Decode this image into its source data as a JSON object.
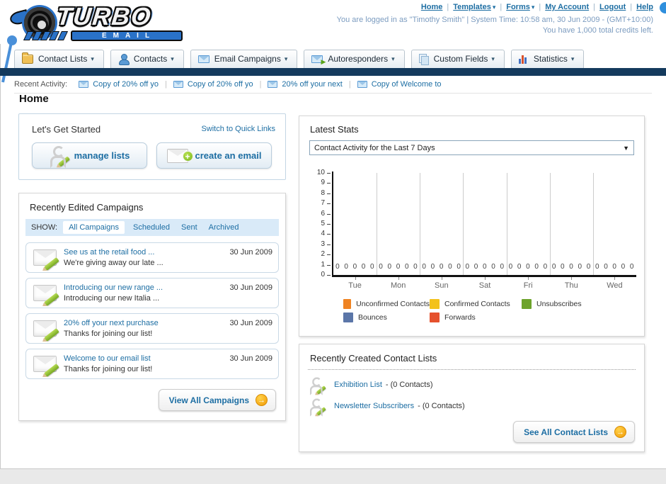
{
  "header": {
    "logo": {
      "line1": "TURBO",
      "line2": "EMAIL"
    },
    "nav": [
      {
        "label": "Home",
        "dropdown": false
      },
      {
        "label": "Templates",
        "dropdown": true
      },
      {
        "label": "Forms",
        "dropdown": true
      },
      {
        "label": "My Account",
        "dropdown": false
      },
      {
        "label": "Logout",
        "dropdown": false
      },
      {
        "label": "Help",
        "dropdown": false
      }
    ],
    "login_line": "You are logged in as \"Timothy Smith\" | System Time: 10:58 am, 30 Jun 2009 - (GMT+10:00)",
    "credits_line": "You have 1,000 total credits left."
  },
  "tabs": [
    {
      "label": "Contact Lists",
      "icon": "contact-lists-icon"
    },
    {
      "label": "Contacts",
      "icon": "contacts-icon"
    },
    {
      "label": "Email Campaigns",
      "icon": "email-campaigns-icon"
    },
    {
      "label": "Autoresponders",
      "icon": "autoresponders-icon"
    },
    {
      "label": "Custom Fields",
      "icon": "custom-fields-icon"
    },
    {
      "label": "Statistics",
      "icon": "statistics-icon"
    }
  ],
  "recent_activity": {
    "label": "Recent Activity:",
    "items": [
      "Copy of 20% off yo",
      "Copy of 20% off yo",
      "20% off your next",
      "Copy of Welcome to"
    ]
  },
  "page_title": "Home",
  "get_started": {
    "title": "Let's Get Started",
    "switch_link": "Switch to Quick Links",
    "buttons": [
      {
        "label": "manage lists"
      },
      {
        "label": "create an email"
      }
    ]
  },
  "campaigns": {
    "title": "Recently Edited Campaigns",
    "show_label": "SHOW:",
    "filters": [
      "All Campaigns",
      "Scheduled",
      "Sent",
      "Archived"
    ],
    "active_filter": "All Campaigns",
    "items": [
      {
        "title": "See us at the retail food ...",
        "subtitle": "We're giving away our late ...",
        "date": "30 Jun 2009"
      },
      {
        "title": "Introducing our new range ...",
        "subtitle": "Introducing our new Italia ...",
        "date": "30 Jun 2009"
      },
      {
        "title": "20% off your next purchase",
        "subtitle": "Thanks for joining our list!",
        "date": "30 Jun 2009"
      },
      {
        "title": "Welcome to our email list",
        "subtitle": "Thanks for joining our list!",
        "date": "30 Jun 2009"
      }
    ],
    "view_all_label": "View All Campaigns"
  },
  "stats": {
    "title": "Latest Stats",
    "selector": "Contact Activity for the Last 7 Days"
  },
  "chart_data": {
    "type": "bar",
    "title": "Contact Activity for the Last 7 Days",
    "categories": [
      "Tue",
      "Mon",
      "Sun",
      "Sat",
      "Fri",
      "Thu",
      "Wed"
    ],
    "series": [
      {
        "name": "Unconfirmed Contacts",
        "color": "#ef8322",
        "values": [
          0,
          0,
          0,
          0,
          0,
          0,
          0
        ]
      },
      {
        "name": "Confirmed Contacts",
        "color": "#f3c21c",
        "values": [
          0,
          0,
          0,
          0,
          0,
          0,
          0
        ]
      },
      {
        "name": "Unsubscribes",
        "color": "#6da32b",
        "values": [
          0,
          0,
          0,
          0,
          0,
          0,
          0
        ]
      },
      {
        "name": "Bounces",
        "color": "#5b76a8",
        "values": [
          0,
          0,
          0,
          0,
          0,
          0,
          0
        ]
      },
      {
        "name": "Forwards",
        "color": "#e5512d",
        "values": [
          0,
          0,
          0,
          0,
          0,
          0,
          0
        ]
      }
    ],
    "ylim": [
      0,
      10
    ],
    "ytick_step": 1,
    "grid": "vertical-group-separators",
    "legend_position": "bottom"
  },
  "contact_lists": {
    "title": "Recently Created Contact Lists",
    "items": [
      {
        "name": "Exhibition List",
        "detail": "- (0 Contacts)"
      },
      {
        "name": "Newsletter Subscribers",
        "detail": "- (0 Contacts)"
      }
    ],
    "see_all_label": "See All Contact Lists"
  }
}
